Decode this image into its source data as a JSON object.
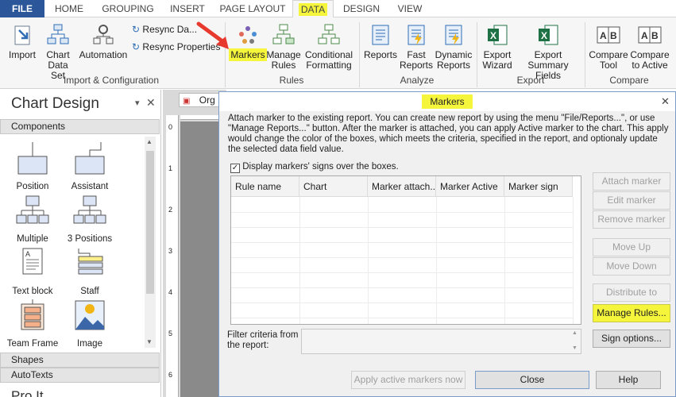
{
  "tabs": [
    "FILE",
    "HOME",
    "GROUPING",
    "INSERT",
    "PAGE LAYOUT",
    "DATA",
    "DESIGN",
    "VIEW"
  ],
  "ribbon": {
    "import": "Import",
    "chart_data_set_1": "Chart",
    "chart_data_set_2": "Data Set",
    "automation": "Automation",
    "resync_data": "Resync Da...",
    "resync_properties": "Resync Properties",
    "group_import": "Import & Configuration",
    "markers": "Markers",
    "manage_rules_1": "Manage",
    "manage_rules_2": "Rules",
    "cond_format_1": "Conditional",
    "cond_format_2": "Formatting",
    "group_rules": "Rules",
    "reports": "Reports",
    "fast_reports_1": "Fast",
    "fast_reports_2": "Reports",
    "dynamic_reports_1": "Dynamic",
    "dynamic_reports_2": "Reports",
    "group_analyze": "Analyze",
    "export_wizard_1": "Export",
    "export_wizard_2": "Wizard",
    "export_summary_1": "Export",
    "export_summary_2": "Summary Fields",
    "group_export": "Export",
    "compare_tool_1": "Compare",
    "compare_tool_2": "Tool",
    "compare_active_1": "Compare",
    "compare_active_2": "to Active",
    "group_compare": "Compare"
  },
  "left_panel": {
    "title": "Chart Design",
    "components_header": "Components",
    "components": [
      "Position",
      "Assistant",
      "Multiple",
      "3 Positions",
      "Text block",
      "Staff",
      "Team Frame",
      "Image"
    ],
    "shapes_header": "Shapes",
    "autotexts_header": "AutoTexts",
    "bottom_cut": "Pro It..."
  },
  "canvas_tab": "Org",
  "ruler_numbers": [
    "0",
    "1",
    "2",
    "3",
    "4",
    "5",
    "6"
  ],
  "dialog": {
    "title": "Markers",
    "description": "Attach marker to the existing report. You can create new report by using the menu \"File/Reports...\", or use \"Manage Reports...\" button. After the marker is attached, you can apply Active marker to the chart. This apply would change the color of the boxes, which meets the criteria, specified in the report, and optionaly update the selected data field value.",
    "checkbox_label": "Display markers' signs over the boxes.",
    "columns": [
      "Rule name",
      "Chart",
      "Marker attach...",
      "Marker Active",
      "Marker sign"
    ],
    "buttons": {
      "attach": "Attach marker",
      "edit": "Edit marker",
      "remove": "Remove  marker",
      "move_up": "Move Up",
      "move_down": "Move Down",
      "distribute": "Distribute to charts",
      "manage_rules": "Manage Rules...",
      "sign_options": "Sign options...",
      "apply": "Apply active markers now",
      "close": "Close",
      "help": "Help"
    },
    "filter_label_1": "Filter criteria from",
    "filter_label_2": "the report:"
  }
}
